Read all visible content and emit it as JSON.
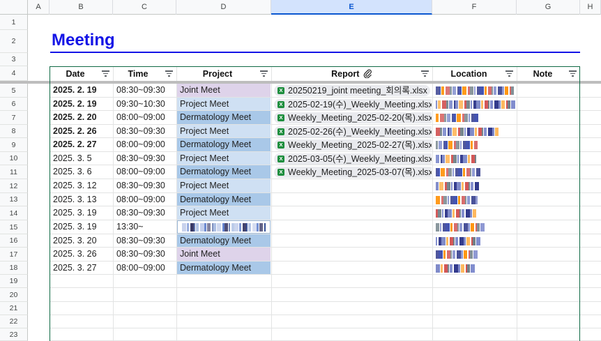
{
  "columns": [
    "A",
    "B",
    "C",
    "D",
    "E",
    "F",
    "G",
    "H"
  ],
  "selected_column": "E",
  "rows": [
    "1",
    "2",
    "3",
    "4",
    "5",
    "6",
    "7",
    "8",
    "9",
    "10",
    "11",
    "12",
    "13",
    "14",
    "15",
    "16",
    "17",
    "18",
    "19",
    "20",
    "21",
    "22",
    "23"
  ],
  "title": "Meeting",
  "headers": {
    "date": "Date",
    "time": "Time",
    "project": "Project",
    "report": "Report",
    "location": "Location",
    "note": "Note"
  },
  "icons": {
    "filter": "filter-icon",
    "attachment": "paperclip-icon",
    "file": "excel-file-icon"
  },
  "colors": {
    "title": "#1414e6",
    "joint": "#ded3ea",
    "project": "#cfe0f3",
    "dermatology": "#a9c8e8",
    "table_border": "#0f6a45",
    "selected_header": "#d3e3fd"
  },
  "meetings": [
    {
      "date": "2025. 2. 19",
      "bold": true,
      "time": "08:30~09:30",
      "project": "Joint Meet",
      "kind": "joint",
      "report": "20250219_joint meeting_회의록.xlsx"
    },
    {
      "date": "2025. 2. 19",
      "bold": true,
      "time": "09:30~10:30",
      "project": "Project Meet",
      "kind": "project",
      "report": "2025-02-19(수)_Weekly_Meeting.xlsx"
    },
    {
      "date": "2025. 2. 20",
      "bold": true,
      "time": "08:00~09:00",
      "project": "Dermatology Meet",
      "kind": "dermatology",
      "report": "Weekly_Meeting_2025-02-20(목).xlsx"
    },
    {
      "date": "2025. 2. 26",
      "bold": true,
      "time": "08:30~09:30",
      "project": "Project Meet",
      "kind": "project",
      "report": "2025-02-26(수)_Weekly_Meeting.xlsx"
    },
    {
      "date": "2025. 2. 27",
      "bold": true,
      "time": "08:00~09:00",
      "project": "Dermatology Meet",
      "kind": "dermatology",
      "report": "Weekly_Meeting_2025-02-27(목).xlsx"
    },
    {
      "date": "2025. 3. 5",
      "bold": false,
      "time": "08:30~09:30",
      "project": "Project Meet",
      "kind": "project",
      "report": "2025-03-05(수)_Weekly_Meeting.xlsx"
    },
    {
      "date": "2025. 3. 6",
      "bold": false,
      "time": "08:00~09:00",
      "project": "Dermatology Meet",
      "kind": "dermatology",
      "report": "Weekly_Meeting_2025-03-07(목).xlsx"
    },
    {
      "date": "2025. 3. 12",
      "bold": false,
      "time": "08:30~09:30",
      "project": "Project Meet",
      "kind": "project",
      "report": ""
    },
    {
      "date": "2025. 3. 13",
      "bold": false,
      "time": "08:00~09:00",
      "project": "Dermatology Meet",
      "kind": "dermatology",
      "report": ""
    },
    {
      "date": "2025. 3. 19",
      "bold": false,
      "time": "08:30~09:30",
      "project": "Project Meet",
      "kind": "project",
      "report": ""
    },
    {
      "date": "2025. 3. 19",
      "bold": false,
      "time": "13:30~",
      "project": "",
      "kind": "redacted",
      "report": ""
    },
    {
      "date": "2025. 3. 20",
      "bold": false,
      "time": "08:30~09:30",
      "project": "Dermatology Meet",
      "kind": "dermatology",
      "report": ""
    },
    {
      "date": "2025. 3. 26",
      "bold": false,
      "time": "08:30~09:30",
      "project": "Joint Meet",
      "kind": "joint",
      "report": ""
    },
    {
      "date": "2025. 3. 27",
      "bold": false,
      "time": "08:00~09:00",
      "project": "Dermatology Meet",
      "kind": "dermatology",
      "report": ""
    }
  ]
}
